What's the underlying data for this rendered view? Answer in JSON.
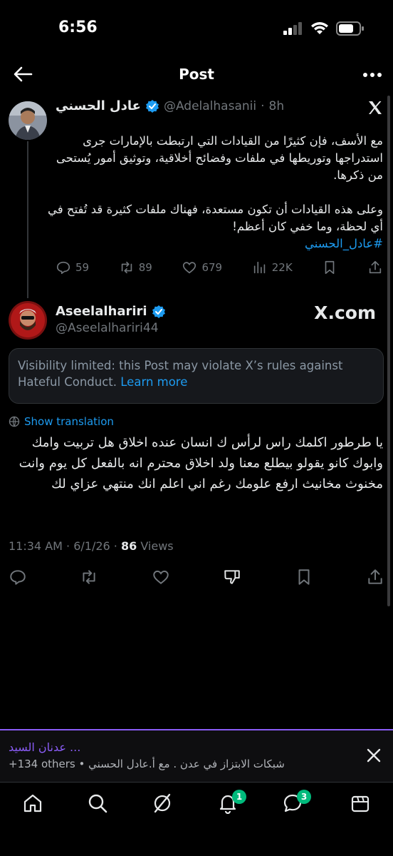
{
  "status_bar": {
    "time": "6:56"
  },
  "header": {
    "title": "Post"
  },
  "tweet1": {
    "name": "عادل الحسني",
    "handle": "@Adelalhasanii",
    "time": "8h",
    "text": "مع الأسف، فإن كثيرًا من القيادات التي ارتبطت بالإمارات جرى استدراجها وتوريطها في ملفات وفضائح أخلاقية، وتوثيق أمور يُستحى من ذكرها.\n\nوعلى هذه القيادات أن تكون مستعدة، فهناك ملفات كثيرة قد تُفتح في أي لحظة، وما خفي كان أعظم!",
    "hashtag": "#عادل_الحسني",
    "replies": "59",
    "reposts": "89",
    "likes": "679",
    "views": "22K"
  },
  "tweet2": {
    "name": "Aseelalhariri",
    "handle": "@Aseelalhariri44",
    "watermark": "X.com",
    "visibility_text": "Visibility limited: this Post may violate X’s rules against Hateful Conduct.",
    "visibility_link": "Learn more",
    "translate_label": "Show translation",
    "text": "يا طرطور اكلمك راس لرأس ك انسان عنده اخلاق هل تربيت وامك وابوك كانو يقولو بيطلع معنا ولد اخلاق محترم انه بالفعل كل يوم وانت مخنوث مخانيث ارفع علومك رغم اني اعلم انك منتهي عزاي لك",
    "timestamp": "11:34 AM · 6/1/26 · ",
    "views_count": "86",
    "views_label": " Views"
  },
  "banner": {
    "title": "عدنان السيد ...",
    "subtitle": "+134 others • شبكات الابتزاز في عدن . مع أ.عادل الحسني"
  },
  "bottom_nav": {
    "notifications_badge": "1",
    "messages_badge": "3"
  },
  "colors": {
    "accent": "#1d9bf0",
    "verified": "#1d9bf0",
    "badge": "#00ba7c"
  }
}
